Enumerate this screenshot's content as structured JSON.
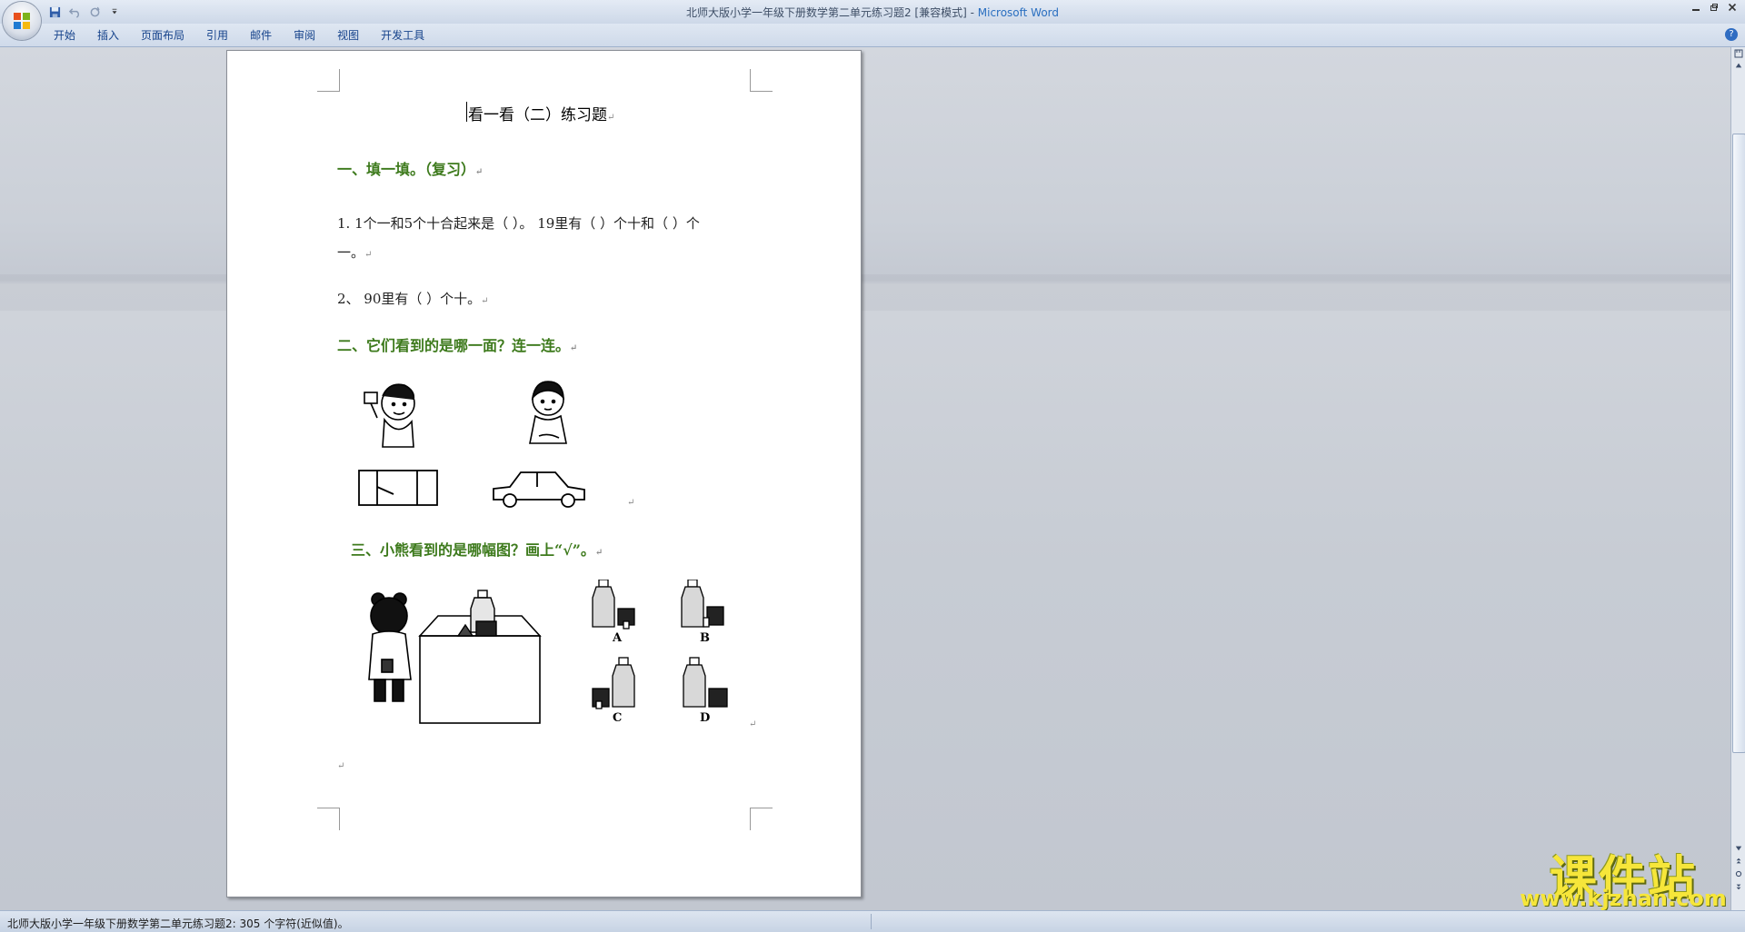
{
  "window": {
    "title": "北师大版小学一年级下册数学第二单元练习题2 [兼容模式]",
    "title_separator": " - ",
    "app_name": "Microsoft Word"
  },
  "quick_access": {
    "items": [
      "save-icon",
      "undo-icon",
      "redo-icon",
      "customize-icon"
    ]
  },
  "ribbon": {
    "tabs": [
      "开始",
      "插入",
      "页面布局",
      "引用",
      "邮件",
      "审阅",
      "视图",
      "开发工具"
    ],
    "help": "?"
  },
  "document": {
    "title": "看一看（二）练习题",
    "section1_heading": "一、填一填。（复习）",
    "q1_line1": "1. 1个一和5个十合起来是（ ）。 19里有（ ）个十和（ ）个",
    "q1_line2": "一。",
    "q2": "2、  90里有（ ）个十。",
    "section2_heading": "二、它们看到的是哪一面？连一连。",
    "section3_heading": "三、小熊看到的是哪幅图？画上“√”。",
    "option_labels": [
      "A",
      "B",
      "C",
      "D"
    ],
    "paragraph_mark": "↵"
  },
  "status_bar": {
    "text": "北师大版小学一年级下册数学第二单元练习题2: 305 个字符(近似值)。"
  },
  "watermark": {
    "title": "课件站",
    "url": "www.kjzhan.com"
  },
  "colors": {
    "heading_green": "#3d7a1c",
    "ribbon_text": "#15428b",
    "watermark_yellow": "#f6e63a"
  }
}
